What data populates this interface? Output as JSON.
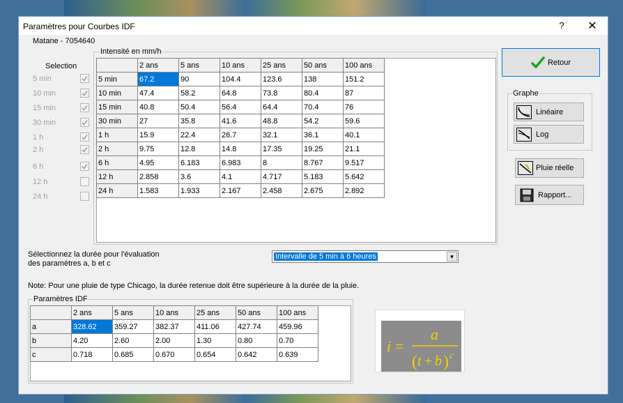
{
  "window": {
    "title": "Paramètres pour Courbes IDF",
    "help": "?",
    "close": "✕"
  },
  "station": "Matane - 7054640",
  "selection": {
    "label": "Selection",
    "items": [
      {
        "label": "5 min",
        "checked": true
      },
      {
        "label": "10 min",
        "checked": true
      },
      {
        "label": "15 min",
        "checked": true
      },
      {
        "label": "30 min",
        "checked": true
      },
      {
        "label": "1 h",
        "checked": true
      },
      {
        "label": "2 h",
        "checked": true
      },
      {
        "label": "6 h",
        "checked": true
      },
      {
        "label": "12 h",
        "checked": false
      },
      {
        "label": "24 h",
        "checked": false
      }
    ]
  },
  "intensity": {
    "caption": "Intensité en mm/h",
    "columns": [
      "2 ans",
      "5 ans",
      "10 ans",
      "25 ans",
      "50 ans",
      "100 ans"
    ],
    "rows": [
      {
        "label": "5 min",
        "values": [
          "67.2",
          "90",
          "104.4",
          "123.6",
          "138",
          "151.2"
        ]
      },
      {
        "label": "10 min",
        "values": [
          "47.4",
          "58.2",
          "64.8",
          "73.8",
          "80.4",
          "87"
        ]
      },
      {
        "label": "15 min",
        "values": [
          "40.8",
          "50.4",
          "56.4",
          "64.4",
          "70.4",
          "76"
        ]
      },
      {
        "label": "30 min",
        "values": [
          "27",
          "35.8",
          "41.6",
          "48.8",
          "54.2",
          "59.6"
        ]
      },
      {
        "label": "1 h",
        "values": [
          "15.9",
          "22.4",
          "26.7",
          "32.1",
          "36.1",
          "40.1"
        ]
      },
      {
        "label": "2 h",
        "values": [
          "9.75",
          "12.8",
          "14.8",
          "17.35",
          "19.25",
          "21.1"
        ]
      },
      {
        "label": "6 h",
        "values": [
          "4.95",
          "6.183",
          "6.983",
          "8",
          "8.767",
          "9.517"
        ]
      },
      {
        "label": "12 h",
        "values": [
          "2.858",
          "3.6",
          "4.1",
          "4.717",
          "5.183",
          "5.642"
        ]
      },
      {
        "label": "24 h",
        "values": [
          "1.583",
          "1.933",
          "2.167",
          "2.458",
          "2.675",
          "2.892"
        ]
      }
    ]
  },
  "buttons": {
    "retour": "Retour",
    "graphe_caption": "Graphe",
    "lineaire": "Linéaire",
    "log": "Log",
    "pluie_reelle": "Pluie réelle",
    "rapport": "Rapport..."
  },
  "duration": {
    "label_line1": "Sélectionnez la durée pour l'évaluation",
    "label_line2": "des paramètres a, b et c",
    "selected": "Intervalle de 5 min à 6 heures"
  },
  "note": "Note: Pour une pluie de type Chicago, la durée retenue doit être supérieure à la durée de la pluie.",
  "idf": {
    "caption": "Paramètres IDF",
    "columns": [
      "2 ans",
      "5 ans",
      "10 ans",
      "25 ans",
      "50 ans",
      "100 ans"
    ],
    "rows": [
      {
        "label": "a",
        "values": [
          "328.62",
          "359.27",
          "382.37",
          "411.06",
          "427.74",
          "459.96"
        ]
      },
      {
        "label": "b",
        "values": [
          "4.20",
          "2.60",
          "2.00",
          "1.30",
          "0.80",
          "0.70"
        ]
      },
      {
        "label": "c",
        "values": [
          "0.718",
          "0.685",
          "0.670",
          "0.654",
          "0.642",
          "0.639"
        ]
      }
    ]
  },
  "formula": {
    "lhs": "i",
    "equals": "=",
    "numerator": "a",
    "denominator_open": "(",
    "denominator_t": "t",
    "denominator_plus": "+",
    "denominator_b": "b",
    "denominator_close": ")",
    "exponent": "c"
  },
  "colors": {
    "selection_highlight": "#0078d7",
    "formula_text": "#f2d200",
    "formula_bg": "#8c8c8c",
    "check_green": "#1aa321"
  }
}
